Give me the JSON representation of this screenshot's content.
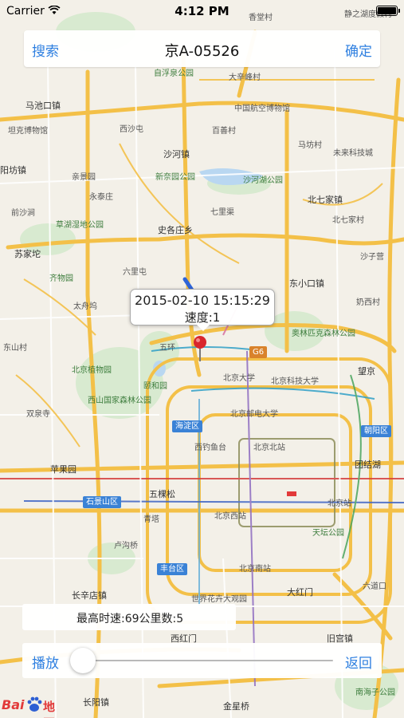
{
  "status_bar": {
    "carrier": "Carrier",
    "time": "4:12 PM"
  },
  "nav": {
    "left": "搜索",
    "title": "京A-05526",
    "right": "确定"
  },
  "callout": {
    "time": "2015-02-10 15:15:29",
    "speed": "速度:1"
  },
  "stats": {
    "text": "最高时速:69公里数:5"
  },
  "player": {
    "play": "播放",
    "back": "返回",
    "progress": 0
  },
  "logo": {
    "bai": "Bai",
    "map": "地图"
  },
  "map_labels": [
    "静之湖度假村",
    "香堂村",
    "自浮泉公园",
    "大辛峰村",
    "马池口镇",
    "坦克博物馆",
    "中国航空博物馆",
    "西沙屯",
    "百善村",
    "马坊村",
    "沙河镇",
    "未来科技城",
    "阳坊镇",
    "新奈园公园",
    "沙河湖公园",
    "亲景园",
    "永泰庄",
    "北七家镇",
    "七里渠",
    "前沙涧",
    "草湖湿地公园",
    "北七家村",
    "史各庄乡",
    "苏家坨",
    "六里屯",
    "沙子营",
    "齐物园",
    "东小口镇",
    "奶西村",
    "太舟坞",
    "奥林匹克森林公园",
    "东山村",
    "五环",
    "G6",
    "北京植物园",
    "北京大学",
    "北京科技大学",
    "望京",
    "颐和园",
    "西山国家森林公园",
    "海淀区",
    "北京邮电大学",
    "朝阳区",
    "双泉寺",
    "苹果园",
    "西钓鱼台",
    "北京北站",
    "团结湖",
    "石景山区",
    "五棵松",
    "北京站",
    "青塔",
    "北京西站",
    "天坛公园",
    "卢沟桥",
    "丰台区",
    "北京南站",
    "长辛店镇",
    "大红门",
    "世界花卉大观园",
    "六道口",
    "西红门",
    "旧宫镇",
    "长阳镇",
    "金星桥",
    "南海子公园"
  ]
}
